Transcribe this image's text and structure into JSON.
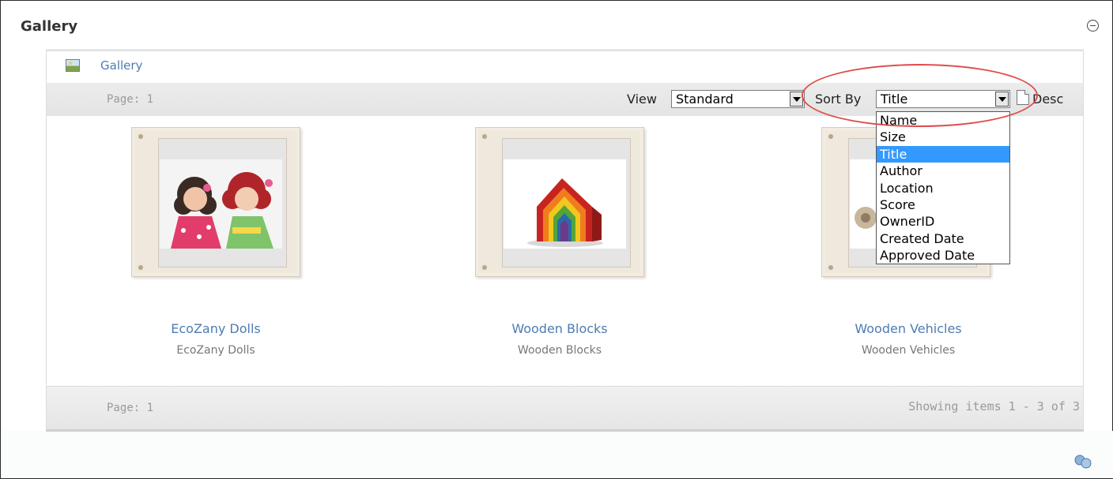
{
  "module": {
    "title": "Gallery"
  },
  "gallery": {
    "breadcrumb": "Gallery"
  },
  "toolbar": {
    "page_label": "Page: 1",
    "view_label": "View",
    "view_value": "Standard",
    "sort_label": "Sort By",
    "sort_value": "Title",
    "desc_label": "Desc"
  },
  "sort_options": [
    "Name",
    "Size",
    "Title",
    "Author",
    "Location",
    "Score",
    "OwnerID",
    "Created Date",
    "Approved Date"
  ],
  "selected_sort": "Title",
  "items": [
    {
      "title": "EcoZany Dolls",
      "description": "EcoZany Dolls"
    },
    {
      "title": "Wooden Blocks",
      "description": "Wooden Blocks"
    },
    {
      "title": "Wooden Vehicles",
      "description": "Wooden Vehicles"
    }
  ],
  "footer": {
    "page_label": "Page: 1",
    "showing": "Showing items 1 - 3 of 3"
  },
  "colors": {
    "link": "#4d7cb2",
    "highlight": "#3399ff",
    "annotation": "#e04a4a"
  }
}
